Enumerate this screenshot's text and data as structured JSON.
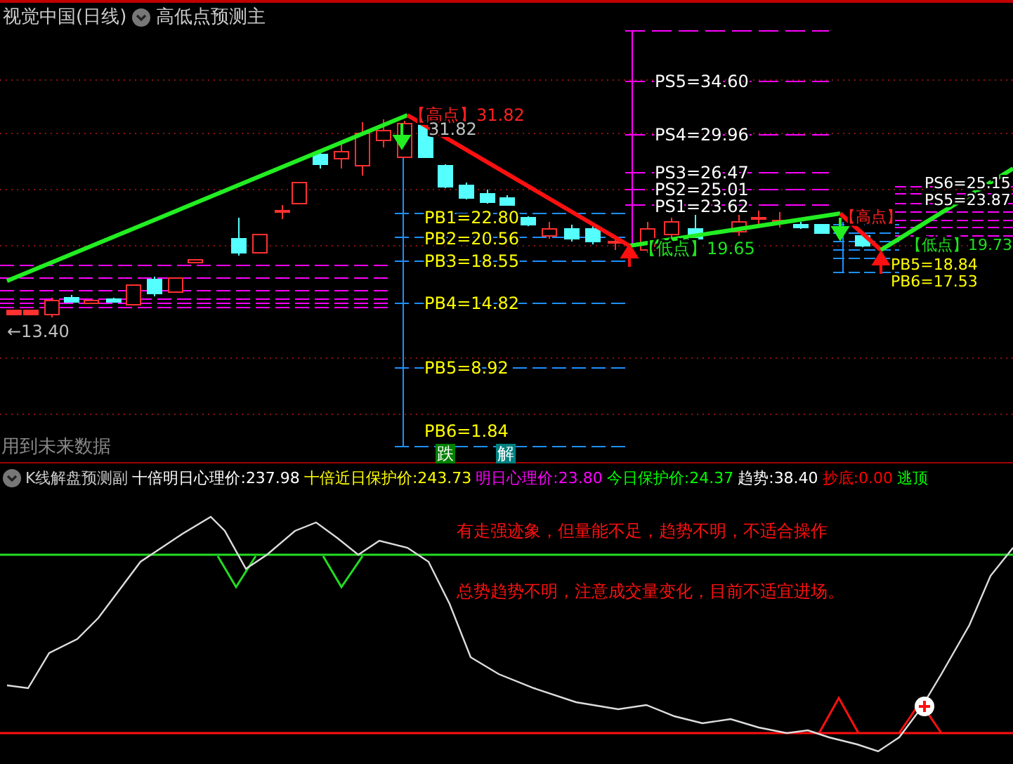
{
  "header": {
    "title": "视觉中国(日线)",
    "indicator": "高低点预测主"
  },
  "main_chart": {
    "labels": [
      {
        "text": "【高点】31.82",
        "kind": "high"
      },
      {
        "text": "31.82",
        "kind": "price"
      },
      {
        "text": "PS5=34.60",
        "kind": "ps"
      },
      {
        "text": "PS4=29.96",
        "kind": "ps"
      },
      {
        "text": "PS3=26.47",
        "kind": "ps"
      },
      {
        "text": "PS2=25.01",
        "kind": "ps"
      },
      {
        "text": "PS1=23.62",
        "kind": "ps"
      },
      {
        "text": "PB1=22.80",
        "kind": "pb"
      },
      {
        "text": "PB2=20.56",
        "kind": "pb"
      },
      {
        "text": "PB3=18.55",
        "kind": "pb"
      },
      {
        "text": "PB4=14.82",
        "kind": "pb"
      },
      {
        "text": "PB5=8.92",
        "kind": "pb"
      },
      {
        "text": "PB6=1.84",
        "kind": "pb"
      },
      {
        "text": "【低点】19.65",
        "kind": "low"
      },
      {
        "text": "←13.40",
        "kind": "price"
      },
      {
        "text": "【高点】",
        "kind": "high"
      },
      {
        "text": "PS6=25.15",
        "kind": "ps"
      },
      {
        "text": "PS5=23.87",
        "kind": "ps"
      },
      {
        "text": "【低点】19.73",
        "kind": "low"
      },
      {
        "text": "PB5=18.84",
        "kind": "pb"
      },
      {
        "text": "PB6=17.53",
        "kind": "pb"
      }
    ],
    "note": "用到未来数据",
    "markers": [
      {
        "text": "跌",
        "kind": "fall"
      },
      {
        "text": "解",
        "kind": "solve"
      }
    ]
  },
  "sub_header": {
    "name": "K线解盘预测副",
    "items": [
      {
        "label": "十倍明日心理价:",
        "value": "237.98",
        "color": "#ffffff"
      },
      {
        "label": "十倍近日保护价:",
        "value": "243.73",
        "color": "#ffff00"
      },
      {
        "label": "明日心理价:",
        "value": "23.80",
        "color": "#ff00ff"
      },
      {
        "label": "今日保护价:",
        "value": "24.37",
        "color": "#00ff00"
      },
      {
        "label": "趋势:",
        "value": "38.40",
        "color": "#ffffff"
      },
      {
        "label": "抄底:",
        "value": "0.00",
        "color": "#ff0000"
      },
      {
        "label": "逃顶",
        "color": "#00ff00"
      }
    ]
  },
  "commentary": [
    "有走强迹象，但量能不足，趋势不明，不适合操作",
    "总势趋势不明，注意成交量变化，目前不适宜进场。"
  ]
}
